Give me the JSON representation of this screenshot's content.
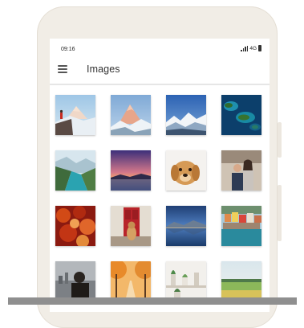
{
  "status_bar": {
    "time": "09:16",
    "network": "4G"
  },
  "app_bar": {
    "title": "Images",
    "menu_icon": "hamburger-menu-icon"
  },
  "gallery": {
    "images": [
      "mountain-hiker-photo",
      "snowy-peak-photo",
      "alpine-range-photo",
      "island-aerial-photo",
      "fjord-photo",
      "sunset-lake-photo",
      "dog-photo",
      "couple-photo",
      "autumn-leaves-photo",
      "dog-at-door-photo",
      "lake-reflection-photo",
      "coastal-village-photo",
      "person-city-view-photo",
      "autumn-path-photo",
      "shelf-plants-photo",
      "field-horizon-photo"
    ]
  }
}
